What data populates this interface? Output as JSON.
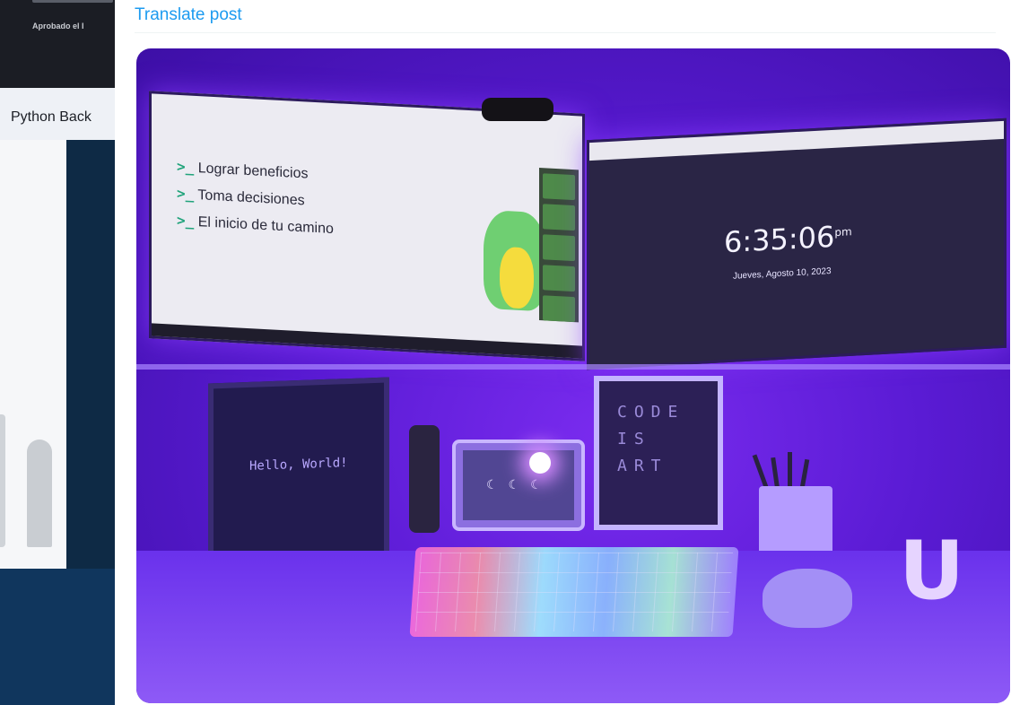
{
  "background_window": {
    "caption": "Aprobado el I",
    "tab_label": "Python Back"
  },
  "post": {
    "translate_link": "Translate post",
    "accent_color": "#1d9bf0"
  },
  "photo": {
    "slide_lines": [
      {
        "prompt": ">_",
        "text": "Lograr beneficios"
      },
      {
        "prompt": ">_",
        "text": "Toma decisiones"
      },
      {
        "prompt": ">_",
        "text": "El inicio de tu camino"
      }
    ],
    "clock_time": "6:35:06",
    "clock_suffix": "pm",
    "clock_date": "Jueves, Agosto 10, 2023",
    "frame_text": "Hello, World!",
    "poster_text": "CODE\nIS\nART",
    "desk_letter": "U"
  }
}
